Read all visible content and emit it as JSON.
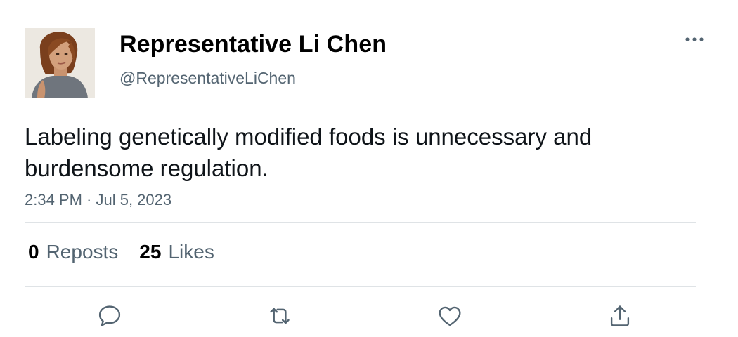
{
  "author": {
    "display_name": "Representative Li Chen",
    "handle": "@RepresentativeLiChen",
    "avatar_icon": "profile-photo"
  },
  "tweet": {
    "text": "Labeling genetically modified foods is unnecessary and burdensome regulation.",
    "timestamp": "2:34 PM · Jul 5, 2023"
  },
  "stats": {
    "reposts_count": "0",
    "reposts_label": "Reposts",
    "likes_count": "25",
    "likes_label": "Likes"
  },
  "actions": {
    "reply_icon": "reply-icon",
    "repost_icon": "repost-icon",
    "like_icon": "heart-icon",
    "share_icon": "share-icon",
    "more_icon": "more-options-icon"
  },
  "colors": {
    "text_primary": "#0f1419",
    "text_secondary": "#536471",
    "divider": "#dfe3e6"
  }
}
